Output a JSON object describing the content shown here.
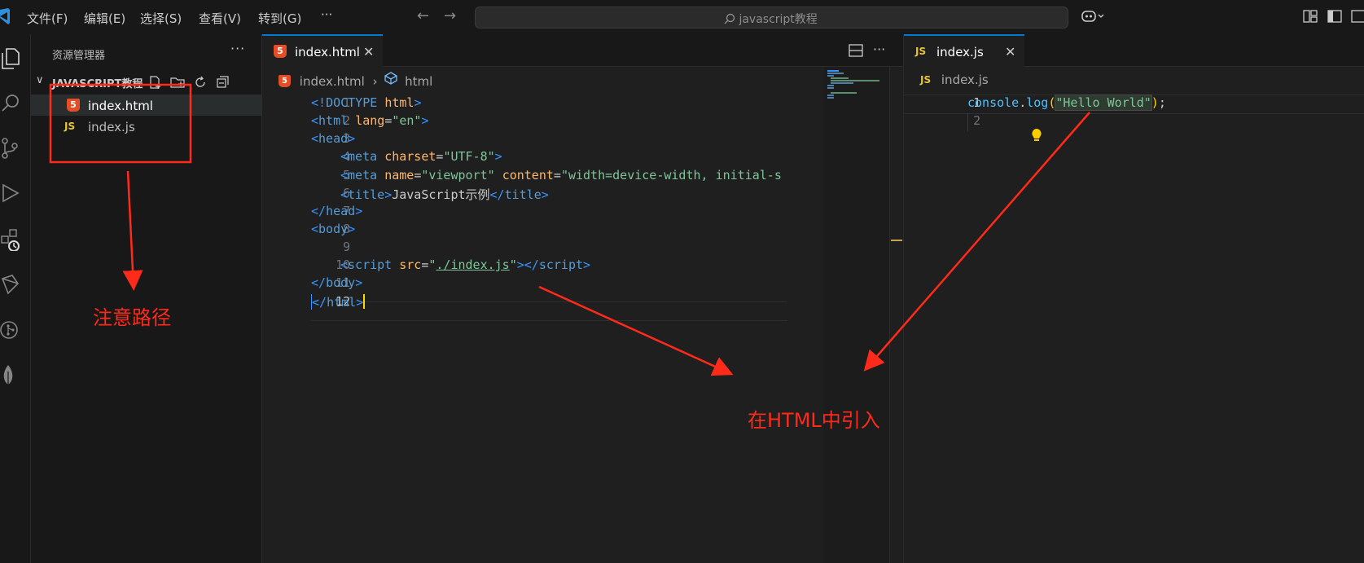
{
  "menu": {
    "file": "文件(F)",
    "edit": "编辑(E)",
    "select": "选择(S)",
    "view": "查看(V)",
    "goto": "转到(G)",
    "more": "···"
  },
  "command_center": {
    "search": "javascript教程"
  },
  "explorer": {
    "title": "资源管理器",
    "more": "···",
    "folder": "JAVASCRIPT教程",
    "files": [
      {
        "name": "index.html",
        "type": "html",
        "icon_text": "5"
      },
      {
        "name": "index.js",
        "type": "js",
        "icon_text": "JS"
      }
    ]
  },
  "editor_left": {
    "tab_label": "index.html",
    "tab_icon_text": "5",
    "close": "✕",
    "breadcrumb": {
      "file": "index.html",
      "sep": "›",
      "symbol": "html"
    },
    "line_numbers": [
      "1",
      "2",
      "3",
      "4",
      "5",
      "6",
      "7",
      "8",
      "9",
      "10",
      "11",
      "12"
    ],
    "code": {
      "l1": {
        "lt": "<!",
        "doctype": "DOCTYPE",
        "html": "html",
        "gt": ">"
      },
      "l2": {
        "lt": "<",
        "tag": "html",
        "attr": "lang",
        "eq": "=",
        "val": "\"en\"",
        "gt": ">"
      },
      "l3": {
        "lt": "<",
        "tag": "head",
        "gt": ">"
      },
      "l4": {
        "lt": "<",
        "tag": "meta",
        "attr": "charset",
        "eq": "=",
        "val": "\"UTF-8\"",
        "gt": ">"
      },
      "l5": {
        "lt": "<",
        "tag": "meta",
        "attr1": "name",
        "eq": "=",
        "val1": "\"viewport\"",
        "attr2": "content",
        "val2": "\"width=device-width, initial-s"
      },
      "l6": {
        "lt": "<",
        "tag": "title",
        "gt": ">",
        "text": "JavaScript示例",
        "lt2": "</",
        "tag2": "title",
        "gt2": ">"
      },
      "l7": {
        "lt": "</",
        "tag": "head",
        "gt": ">"
      },
      "l8": {
        "lt": "<",
        "tag": "body",
        "gt": ">"
      },
      "l10": {
        "lt": "<",
        "tag": "script",
        "attr": "src",
        "eq": "=",
        "q1": "\"",
        "path": "./index.js",
        "q2": "\"",
        "gt": ">",
        "lt2": "</",
        "tag2": "script",
        "gt2": ">"
      },
      "l11": {
        "lt": "</",
        "tag": "body",
        "gt": ">"
      },
      "l12": {
        "lt": "</",
        "tag": "html",
        "gt": ">"
      }
    }
  },
  "editor_right": {
    "tab_label": "index.js",
    "tab_icon_text": "JS",
    "close": "✕",
    "breadcrumb_file": "index.js",
    "line_numbers": [
      "1",
      "2"
    ],
    "code": {
      "obj": "console",
      "dot": ".",
      "fn": "log",
      "open": "(",
      "str": "\"Hello World\"",
      "close": ")",
      "semi": ";"
    }
  },
  "annotations": {
    "path_note": "注意路径",
    "import_note": "在HTML中引入"
  },
  "colors": {
    "annotation": "#ff2a1a",
    "accent": "#0078d4",
    "html_icon": "#e44d26",
    "js_icon": "#e8c33a"
  }
}
